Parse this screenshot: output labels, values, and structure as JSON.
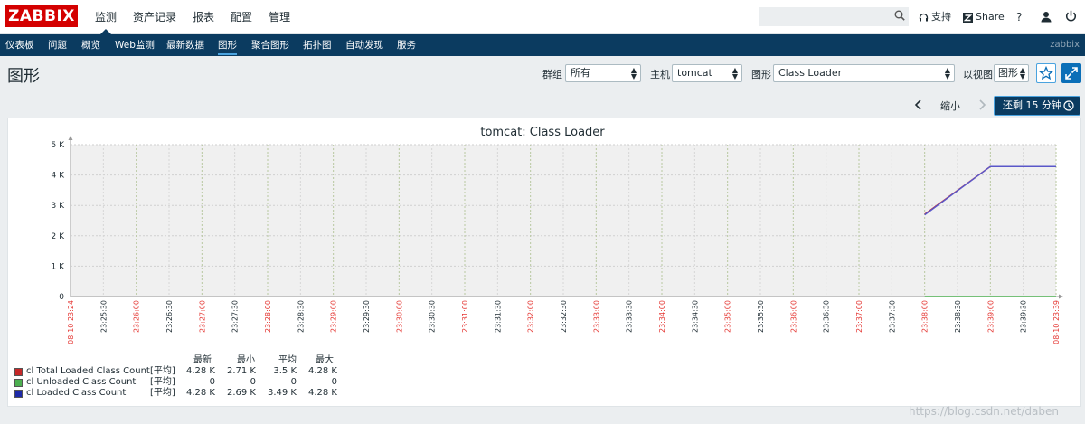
{
  "app": {
    "logo": "ZABBIX",
    "brand": "zabbix"
  },
  "main_menu": [
    "监测",
    "资产记录",
    "报表",
    "配置",
    "管理"
  ],
  "top_links": {
    "support": "支持",
    "share": "Share",
    "help": "?"
  },
  "sub_menu": [
    "仪表板",
    "问题",
    "概览",
    "Web监测",
    "最新数据",
    "图形",
    "聚合图形",
    "拓扑图",
    "自动发现",
    "服务"
  ],
  "page": {
    "title": "图形"
  },
  "filters": {
    "group_label": "群组",
    "group_value": "所有",
    "host_label": "主机",
    "host_value": "tomcat",
    "graph_label": "图形",
    "graph_value": "Class Loader",
    "view_label": "以视图",
    "view_value": "图形"
  },
  "timebar": {
    "zoom_out": "缩小",
    "range_button": "还剩 15 分钟"
  },
  "legend": {
    "headers": [
      "最新",
      "最小",
      "平均",
      "最大"
    ],
    "items": [
      {
        "name": "cl Total Loaded Class Count",
        "func": "[平均]",
        "last": "4.28 K",
        "min": "2.71 K",
        "avg": "3.5 K",
        "max": "4.28 K",
        "color": "#c62828"
      },
      {
        "name": "cl Unloaded Class Count",
        "func": "[平均]",
        "last": "0",
        "min": "0",
        "avg": "0",
        "max": "0",
        "color": "#4caf50"
      },
      {
        "name": "cl Loaded Class Count",
        "func": "[平均]",
        "last": "4.28 K",
        "min": "2.69 K",
        "avg": "3.49 K",
        "max": "4.28 K",
        "color": "#1e2aa8"
      }
    ]
  },
  "watermark": "https://blog.csdn.net/daben",
  "chart_data": {
    "type": "line",
    "title": "tomcat: Class Loader",
    "ylim": [
      0,
      5000
    ],
    "yticks": [
      "5 K",
      "4 K",
      "3 K",
      "2 K",
      "1 K",
      "0"
    ],
    "xticks": [
      {
        "label": "08-10 23:24",
        "red": true
      },
      {
        "label": "23:25:30",
        "red": false
      },
      {
        "label": "23:26:00",
        "red": true
      },
      {
        "label": "23:26:30",
        "red": false
      },
      {
        "label": "23:27:00",
        "red": true
      },
      {
        "label": "23:27:30",
        "red": false
      },
      {
        "label": "23:28:00",
        "red": true
      },
      {
        "label": "23:28:30",
        "red": false
      },
      {
        "label": "23:29:00",
        "red": true
      },
      {
        "label": "23:29:30",
        "red": false
      },
      {
        "label": "23:30:00",
        "red": true
      },
      {
        "label": "23:30:30",
        "red": false
      },
      {
        "label": "23:31:00",
        "red": true
      },
      {
        "label": "23:31:30",
        "red": false
      },
      {
        "label": "23:32:00",
        "red": true
      },
      {
        "label": "23:32:30",
        "red": false
      },
      {
        "label": "23:33:00",
        "red": true
      },
      {
        "label": "23:33:30",
        "red": false
      },
      {
        "label": "23:34:00",
        "red": true
      },
      {
        "label": "23:34:30",
        "red": false
      },
      {
        "label": "23:35:00",
        "red": true
      },
      {
        "label": "23:35:30",
        "red": false
      },
      {
        "label": "23:36:00",
        "red": true
      },
      {
        "label": "23:36:30",
        "red": false
      },
      {
        "label": "23:37:00",
        "red": true
      },
      {
        "label": "23:37:30",
        "red": false
      },
      {
        "label": "23:38:00",
        "red": true
      },
      {
        "label": "23:38:30",
        "red": false
      },
      {
        "label": "23:39:00",
        "red": true
      },
      {
        "label": "23:39:30",
        "red": false
      },
      {
        "label": "08-10 23:39",
        "red": true
      }
    ],
    "series": [
      {
        "name": "cl Total Loaded Class Count",
        "color": "#c62828",
        "points": [
          [
            26,
            2710
          ],
          [
            28,
            4280
          ],
          [
            30,
            4280
          ]
        ]
      },
      {
        "name": "cl Unloaded Class Count",
        "color": "#4caf50",
        "points": [
          [
            26,
            0
          ],
          [
            30,
            0
          ]
        ]
      },
      {
        "name": "cl Loaded Class Count",
        "color": "#5a57c9",
        "points": [
          [
            26,
            2690
          ],
          [
            28,
            4280
          ],
          [
            30,
            4280
          ]
        ]
      }
    ]
  }
}
